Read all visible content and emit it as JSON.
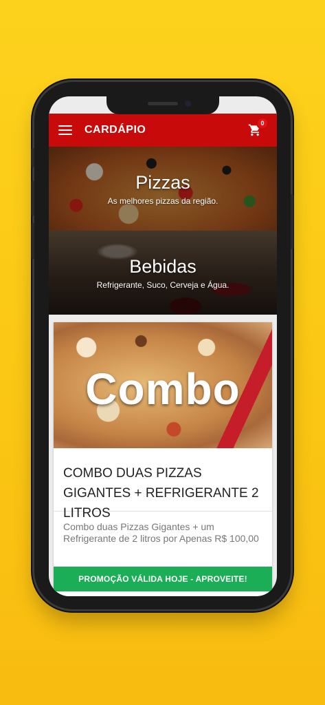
{
  "appbar": {
    "title": "CARDÁPIO",
    "cart_count": "0"
  },
  "categories": [
    {
      "title": "Pizzas",
      "subtitle": "As melhores pizzas da região."
    },
    {
      "title": "Bebidas",
      "subtitle": "Refrigerante, Suco, Cerveja e Água."
    }
  ],
  "card": {
    "image_text": "Combo",
    "title": "COMBO DUAS PIZZAS GIGANTES + REFRIGERANTE 2 LITROS",
    "description": "Combo duas Pizzas Gigantes + um Refrigerante de 2 litros por Apenas R$ 100,00",
    "promo": "PROMOÇÃO VÁLIDA HOJE - APROVEITE!"
  },
  "colors": {
    "background": "#fcd21d",
    "appbar": "#c80a0a",
    "promo": "#1cae57",
    "badge": "#e41313"
  },
  "icons": [
    "menu-icon",
    "cart-icon"
  ]
}
